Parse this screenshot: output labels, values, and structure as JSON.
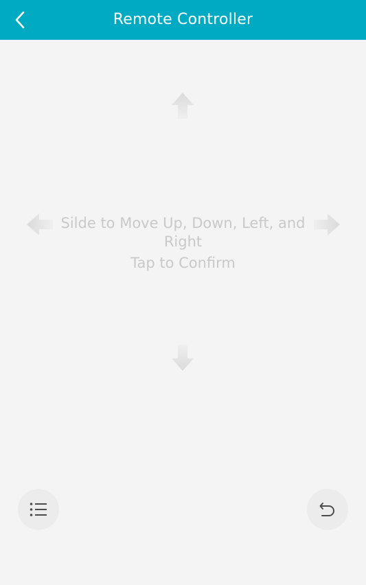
{
  "header": {
    "title": "Remote Controller",
    "back_icon": "chevron-left-icon",
    "background_color": "#00aac2"
  },
  "remote": {
    "hint_line1": "Silde to Move Up, Down, Left, and Right",
    "hint_line2": "Tap to Confirm",
    "arrows": [
      "arrow-up-icon",
      "arrow-down-icon",
      "arrow-left-icon",
      "arrow-right-icon"
    ]
  },
  "bottom_actions": {
    "menu_icon": "list-menu-icon",
    "return_icon": "undo-return-icon"
  }
}
